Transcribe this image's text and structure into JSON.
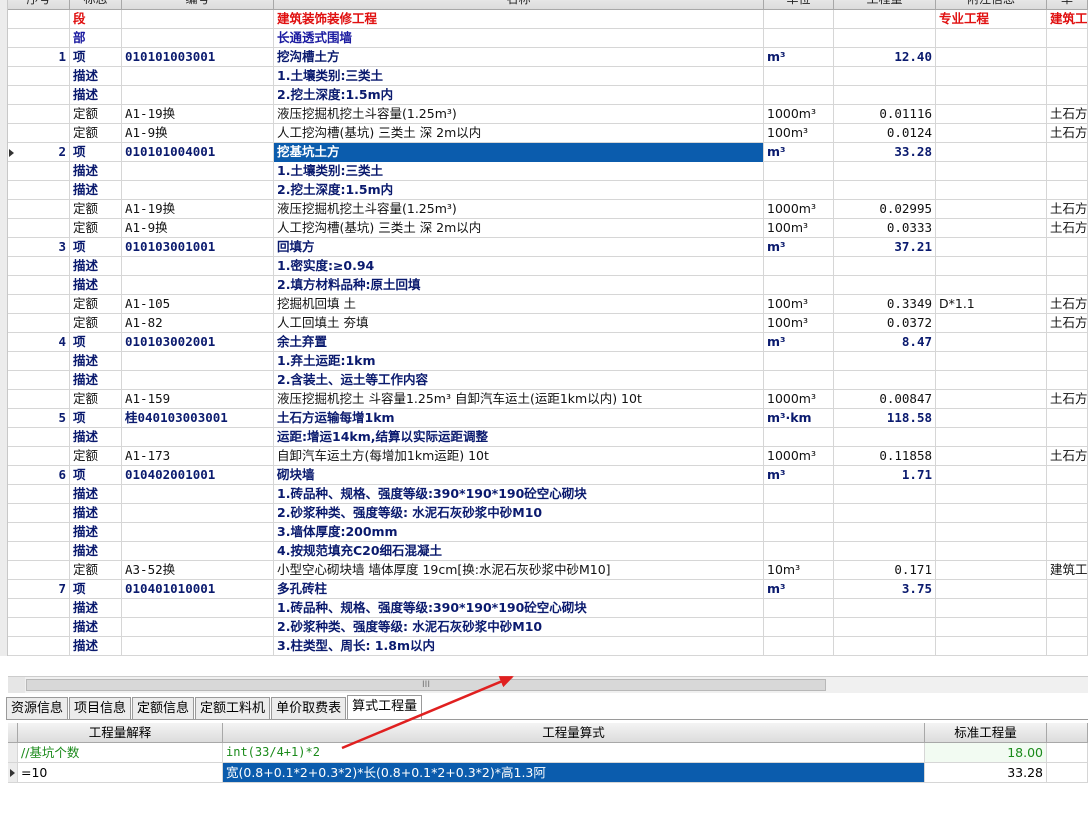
{
  "columns": [
    "序号",
    "标志",
    "编号",
    "名称",
    "单位",
    "工程量",
    "附注信息",
    "单"
  ],
  "rows": [
    {
      "no": "",
      "type": "段",
      "code": "",
      "name": "建筑装饰装修工程",
      "unit": "",
      "qty": "",
      "note": "专业工程",
      "extra": "建筑工",
      "style": "duan"
    },
    {
      "no": "",
      "type": "部",
      "code": "",
      "name": "长通透式围墙",
      "unit": "",
      "qty": "",
      "note": "",
      "extra": "",
      "style": "bu"
    },
    {
      "no": "1",
      "type": "项",
      "code": "010101003001",
      "name": "挖沟槽土方",
      "unit": "m³",
      "qty": "12.40",
      "note": "",
      "extra": "",
      "style": "bold"
    },
    {
      "no": "",
      "type": "描述",
      "code": "",
      "name": "1.土壤类别:三类土",
      "unit": "",
      "qty": "",
      "note": "",
      "extra": "",
      "style": "desc"
    },
    {
      "no": "",
      "type": "描述",
      "code": "",
      "name": "2.挖土深度:1.5m内",
      "unit": "",
      "qty": "",
      "note": "",
      "extra": "",
      "style": "desc"
    },
    {
      "no": "",
      "type": "定额",
      "code": "A1-19换",
      "name": "液压挖掘机挖土斗容量(1.25m³)",
      "unit": "1000m³",
      "qty": "0.01116",
      "note": "",
      "extra": "土石方",
      "style": "ding"
    },
    {
      "no": "",
      "type": "定额",
      "code": "A1-9换",
      "name": "人工挖沟槽(基坑) 三类土 深 2m以内",
      "unit": "100m³",
      "qty": "0.0124",
      "note": "",
      "extra": "土石方",
      "style": "ding"
    },
    {
      "no": "2",
      "type": "项",
      "code": "010101004001",
      "name": "挖基坑土方",
      "unit": "m³",
      "qty": "33.28",
      "note": "",
      "extra": "",
      "style": "bold",
      "selected": true
    },
    {
      "no": "",
      "type": "描述",
      "code": "",
      "name": "1.土壤类别:三类土",
      "unit": "",
      "qty": "",
      "note": "",
      "extra": "",
      "style": "desc"
    },
    {
      "no": "",
      "type": "描述",
      "code": "",
      "name": "2.挖土深度:1.5m内",
      "unit": "",
      "qty": "",
      "note": "",
      "extra": "",
      "style": "desc"
    },
    {
      "no": "",
      "type": "定额",
      "code": "A1-19换",
      "name": "液压挖掘机挖土斗容量(1.25m³)",
      "unit": "1000m³",
      "qty": "0.02995",
      "note": "",
      "extra": "土石方",
      "style": "ding"
    },
    {
      "no": "",
      "type": "定额",
      "code": "A1-9换",
      "name": "人工挖沟槽(基坑) 三类土 深 2m以内",
      "unit": "100m³",
      "qty": "0.0333",
      "note": "",
      "extra": "土石方",
      "style": "ding"
    },
    {
      "no": "3",
      "type": "项",
      "code": "010103001001",
      "name": "回填方",
      "unit": "m³",
      "qty": "37.21",
      "note": "",
      "extra": "",
      "style": "bold"
    },
    {
      "no": "",
      "type": "描述",
      "code": "",
      "name": "1.密实度:≥0.94",
      "unit": "",
      "qty": "",
      "note": "",
      "extra": "",
      "style": "desc"
    },
    {
      "no": "",
      "type": "描述",
      "code": "",
      "name": "2.填方材料品种:原土回填",
      "unit": "",
      "qty": "",
      "note": "",
      "extra": "",
      "style": "desc"
    },
    {
      "no": "",
      "type": "定额",
      "code": "A1-105",
      "name": "挖掘机回填 土",
      "unit": "100m³",
      "qty": "0.3349",
      "note": "D*1.1",
      "extra": "土石方",
      "style": "ding"
    },
    {
      "no": "",
      "type": "定额",
      "code": "A1-82",
      "name": "人工回填土 夯填",
      "unit": "100m³",
      "qty": "0.0372",
      "note": "",
      "extra": "土石方",
      "style": "ding"
    },
    {
      "no": "4",
      "type": "项",
      "code": "010103002001",
      "name": "余土弃置",
      "unit": "m³",
      "qty": "8.47",
      "note": "",
      "extra": "",
      "style": "bold"
    },
    {
      "no": "",
      "type": "描述",
      "code": "",
      "name": "1.弃土运距:1km",
      "unit": "",
      "qty": "",
      "note": "",
      "extra": "",
      "style": "desc"
    },
    {
      "no": "",
      "type": "描述",
      "code": "",
      "name": "2.含装土、运土等工作内容",
      "unit": "",
      "qty": "",
      "note": "",
      "extra": "",
      "style": "desc"
    },
    {
      "no": "",
      "type": "定额",
      "code": "A1-159",
      "name": "液压挖掘机挖土 斗容量1.25m³ 自卸汽车运土(运距1km以内) 10t",
      "unit": "1000m³",
      "qty": "0.00847",
      "note": "",
      "extra": "土石方",
      "style": "ding"
    },
    {
      "no": "5",
      "type": "项",
      "code": "桂040103003001",
      "name": "土石方运输每增1km",
      "unit": "m³·km",
      "qty": "118.58",
      "note": "",
      "extra": "",
      "style": "bold"
    },
    {
      "no": "",
      "type": "描述",
      "code": "",
      "name": "运距:增运14km,结算以实际运距调整",
      "unit": "",
      "qty": "",
      "note": "",
      "extra": "",
      "style": "desc"
    },
    {
      "no": "",
      "type": "定额",
      "code": "A1-173",
      "name": "自卸汽车运土方(每增加1km运距) 10t",
      "unit": "1000m³",
      "qty": "0.11858",
      "note": "",
      "extra": "土石方",
      "style": "ding"
    },
    {
      "no": "6",
      "type": "项",
      "code": "010402001001",
      "name": "砌块墙",
      "unit": "m³",
      "qty": "1.71",
      "note": "",
      "extra": "",
      "style": "bold"
    },
    {
      "no": "",
      "type": "描述",
      "code": "",
      "name": "1.砖品种、规格、强度等级:390*190*190砼空心砌块",
      "unit": "",
      "qty": "",
      "note": "",
      "extra": "",
      "style": "desc"
    },
    {
      "no": "",
      "type": "描述",
      "code": "",
      "name": "2.砂浆种类、强度等级: 水泥石灰砂浆中砂M10",
      "unit": "",
      "qty": "",
      "note": "",
      "extra": "",
      "style": "desc"
    },
    {
      "no": "",
      "type": "描述",
      "code": "",
      "name": "3.墙体厚度:200mm",
      "unit": "",
      "qty": "",
      "note": "",
      "extra": "",
      "style": "desc"
    },
    {
      "no": "",
      "type": "描述",
      "code": "",
      "name": "4.按规范填充C20细石混凝土",
      "unit": "",
      "qty": "",
      "note": "",
      "extra": "",
      "style": "desc"
    },
    {
      "no": "",
      "type": "定额",
      "code": "A3-52换",
      "name": "小型空心砌块墙 墙体厚度 19cm[换:水泥石灰砂浆中砂M10]",
      "unit": "10m³",
      "qty": "0.171",
      "note": "",
      "extra": "建筑工",
      "style": "ding"
    },
    {
      "no": "7",
      "type": "项",
      "code": "010401010001",
      "name": "多孔砖柱",
      "unit": "m³",
      "qty": "3.75",
      "note": "",
      "extra": "",
      "style": "bold"
    },
    {
      "no": "",
      "type": "描述",
      "code": "",
      "name": "1.砖品种、规格、强度等级:390*190*190砼空心砌块",
      "unit": "",
      "qty": "",
      "note": "",
      "extra": "",
      "style": "desc"
    },
    {
      "no": "",
      "type": "描述",
      "code": "",
      "name": "2.砂浆种类、强度等级: 水泥石灰砂浆中砂M10",
      "unit": "",
      "qty": "",
      "note": "",
      "extra": "",
      "style": "desc"
    },
    {
      "no": "",
      "type": "描述",
      "code": "",
      "name": "3.柱类型、周长: 1.8m以内",
      "unit": "",
      "qty": "",
      "note": "",
      "extra": "",
      "style": "desc"
    }
  ],
  "scrollbar": {
    "thumb_label": "III"
  },
  "tabs": [
    "资源信息",
    "项目信息",
    "定额信息",
    "定额工料机",
    "单价取费表",
    "算式工程量"
  ],
  "active_tab": 5,
  "formula_table": {
    "columns": [
      "工程量解释",
      "工程量算式",
      "标准工程量"
    ],
    "rows": [
      {
        "explain": "//基坑个数",
        "formula": "int(33/4+1)*2",
        "qty": "18.00",
        "green": true
      },
      {
        "explain": "=10",
        "formula": "宽(0.8+0.1*2+0.3*2)*长(0.8+0.1*2+0.3*2)*高1.3阿",
        "qty": "33.28",
        "selected": true
      }
    ]
  },
  "colors": {
    "selection": "#0b5cad",
    "annotation_arrow": "#e02020",
    "section_red": "#e01010",
    "item_blue": "#0a1a6e"
  }
}
